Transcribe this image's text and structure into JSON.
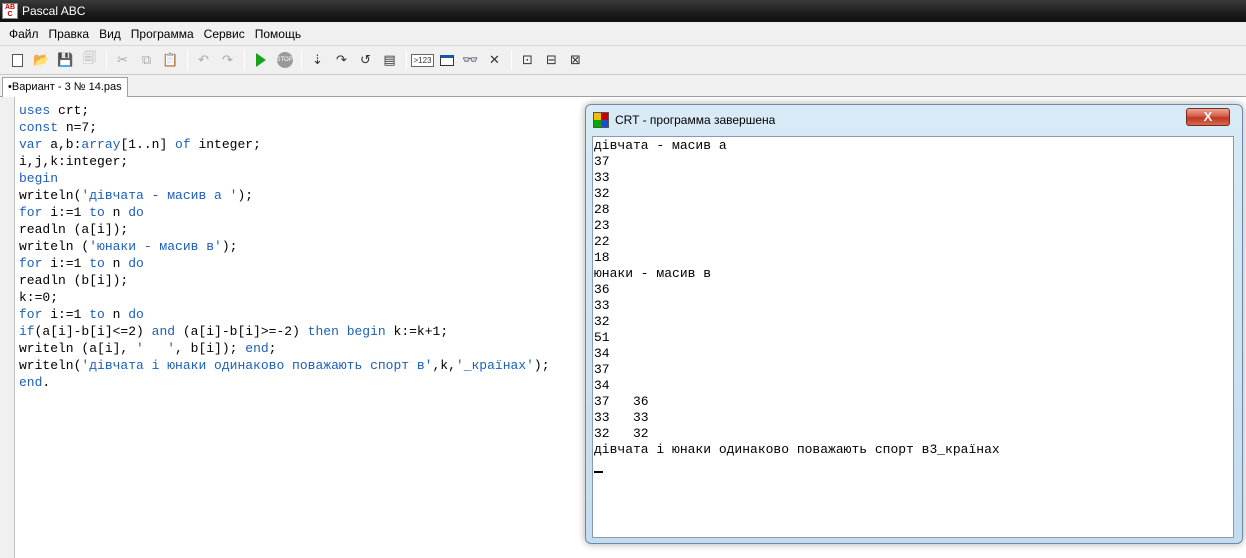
{
  "window": {
    "title": "Pascal ABC",
    "icon_text": "AB C"
  },
  "menu": {
    "items": [
      "Файл",
      "Правка",
      "Вид",
      "Программа",
      "Сервис",
      "Помощь"
    ]
  },
  "toolbar": {
    "buttons": [
      {
        "name": "new-file-icon",
        "glyph": ""
      },
      {
        "name": "open-file-icon",
        "glyph": "📂"
      },
      {
        "name": "save-icon",
        "glyph": "💾"
      },
      {
        "name": "save-all-icon",
        "glyph": "🗐"
      },
      {
        "name": "cut-icon",
        "glyph": "✂"
      },
      {
        "name": "copy-icon",
        "glyph": "⧉"
      },
      {
        "name": "paste-icon",
        "glyph": "📋"
      },
      {
        "name": "undo-icon",
        "glyph": "↶"
      },
      {
        "name": "redo-icon",
        "glyph": "↷"
      },
      {
        "name": "run-icon",
        "glyph": ""
      },
      {
        "name": "stop-icon",
        "glyph": "STOP"
      },
      {
        "name": "step-into-icon",
        "glyph": "⇣"
      },
      {
        "name": "step-over-icon",
        "glyph": "↷"
      },
      {
        "name": "step-out-icon",
        "glyph": "↺"
      },
      {
        "name": "debug-window-icon",
        "glyph": "▤"
      },
      {
        "name": "output-numbers-icon",
        "glyph": ">123"
      },
      {
        "name": "crt-window-icon",
        "glyph": ""
      },
      {
        "name": "watch-icon",
        "glyph": "👓"
      },
      {
        "name": "close-debug-icon",
        "glyph": "✕"
      },
      {
        "name": "format-1-icon",
        "glyph": "⊡"
      },
      {
        "name": "format-2-icon",
        "glyph": "⊟"
      },
      {
        "name": "format-3-icon",
        "glyph": "⊠"
      }
    ]
  },
  "tabs": [
    {
      "label": "•Вариант - 3  № 14.pas"
    }
  ],
  "editor": {
    "lines": [
      [
        [
          "kw",
          "uses"
        ],
        [
          "n",
          " crt;"
        ]
      ],
      [
        [
          "kw",
          "const"
        ],
        [
          "n",
          " n=7;"
        ]
      ],
      [
        [
          "kw",
          "var"
        ],
        [
          "n",
          " a,b:"
        ],
        [
          "kw",
          "array"
        ],
        [
          "n",
          "[1..n] "
        ],
        [
          "kw",
          "of"
        ],
        [
          "n",
          " integer;"
        ]
      ],
      [
        [
          "n",
          "i,j,k:integer;"
        ]
      ],
      [
        [
          "kw",
          "begin"
        ]
      ],
      [
        [
          "n",
          "writeln("
        ],
        [
          "str",
          "'дівчата - масив а '"
        ],
        [
          "n",
          ");"
        ]
      ],
      [
        [
          "kw",
          "for"
        ],
        [
          "n",
          " i:=1 "
        ],
        [
          "kw",
          "to"
        ],
        [
          "n",
          " n "
        ],
        [
          "kw",
          "do"
        ]
      ],
      [
        [
          "n",
          "readln (a[i]);"
        ]
      ],
      [
        [
          "n",
          "writeln ("
        ],
        [
          "str",
          "'юнаки - масив в'"
        ],
        [
          "n",
          ");"
        ]
      ],
      [
        [
          "kw",
          "for"
        ],
        [
          "n",
          " i:=1 "
        ],
        [
          "kw",
          "to"
        ],
        [
          "n",
          " n "
        ],
        [
          "kw",
          "do"
        ]
      ],
      [
        [
          "n",
          "readln (b[i]);"
        ]
      ],
      [
        [
          "n",
          "k:=0;"
        ]
      ],
      [
        [
          "kw",
          "for"
        ],
        [
          "n",
          " i:=1 "
        ],
        [
          "kw",
          "to"
        ],
        [
          "n",
          " n "
        ],
        [
          "kw",
          "do"
        ]
      ],
      [
        [
          "kw",
          "if"
        ],
        [
          "n",
          "(a[i]-b[i]<=2) "
        ],
        [
          "kw",
          "and"
        ],
        [
          "n",
          " (a[i]-b[i]>=-2) "
        ],
        [
          "kw",
          "then"
        ],
        [
          "n",
          " "
        ],
        [
          "kw",
          "begin"
        ],
        [
          "n",
          " k:=k+1;"
        ]
      ],
      [
        [
          "n",
          "writeln (a[i], "
        ],
        [
          "str",
          "'   '"
        ],
        [
          "n",
          ", b[i]); "
        ],
        [
          "kw",
          "end"
        ],
        [
          "n",
          ";"
        ]
      ],
      [
        [
          "n",
          "writeln("
        ],
        [
          "str",
          "'дівчата і юнаки одинаково поважають спорт в'"
        ],
        [
          "n",
          ",k,"
        ],
        [
          "str",
          "'_країнах'"
        ],
        [
          "n",
          ");"
        ]
      ],
      [
        [
          "kw",
          "end"
        ],
        [
          "n",
          "."
        ]
      ]
    ]
  },
  "crt": {
    "title": "CRT - программа завершена",
    "close_label": "X",
    "output_lines": [
      "дівчата - масив а",
      "37",
      "33",
      "32",
      "28",
      "23",
      "22",
      "18",
      "юнаки - масив в",
      "36",
      "33",
      "32",
      "51",
      "34",
      "37",
      "34",
      "37   36",
      "33   33",
      "32   32",
      "дівчата і юнаки одинаково поважають спорт в3_країнах"
    ]
  }
}
